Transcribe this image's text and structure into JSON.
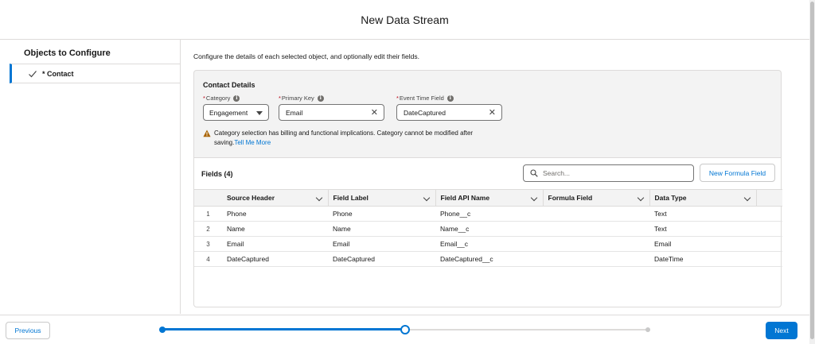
{
  "header": {
    "title": "New Data Stream"
  },
  "sidebar": {
    "heading": "Objects to Configure",
    "items": [
      {
        "label": "* Contact",
        "selected": true
      }
    ]
  },
  "main": {
    "intro": "Configure the details of each selected object, and optionally edit their fields.",
    "details": {
      "title": "Contact Details",
      "category": {
        "label": "Category",
        "value": "Engagement"
      },
      "primary_key": {
        "label": "Primary Key",
        "value": "Email"
      },
      "event_time": {
        "label": "Event Time Field",
        "value": "DateCaptured"
      },
      "required_marker": "*",
      "info_glyph": "i",
      "warning_text": "Category selection has billing and functional implications. Category cannot be modified after saving.",
      "warning_link": "Tell Me More"
    },
    "fields": {
      "title": "Fields (4)",
      "search_placeholder": "Search...",
      "new_formula_label": "New Formula Field",
      "columns": [
        "Source Header",
        "Field Label",
        "Field API Name",
        "Formula Field",
        "Data Type"
      ],
      "rows": [
        {
          "num": "1",
          "source": "Phone",
          "label": "Phone",
          "api": "Phone__c",
          "formula": "",
          "type": "Text"
        },
        {
          "num": "2",
          "source": "Name",
          "label": "Name",
          "api": "Name__c",
          "formula": "",
          "type": "Text"
        },
        {
          "num": "3",
          "source": "Email",
          "label": "Email",
          "api": "Email__c",
          "formula": "",
          "type": "Email"
        },
        {
          "num": "4",
          "source": "DateCaptured",
          "label": "DateCaptured",
          "api": "DateCaptured__c",
          "formula": "",
          "type": "DateTime"
        }
      ]
    }
  },
  "footer": {
    "previous_label": "Previous",
    "next_label": "Next",
    "progress": {
      "steps": 3,
      "current_step": 2,
      "fraction_complete": 0.5
    }
  },
  "colors": {
    "brand": "#0176d3",
    "warning": "#a96404",
    "required": "#ba0517"
  }
}
